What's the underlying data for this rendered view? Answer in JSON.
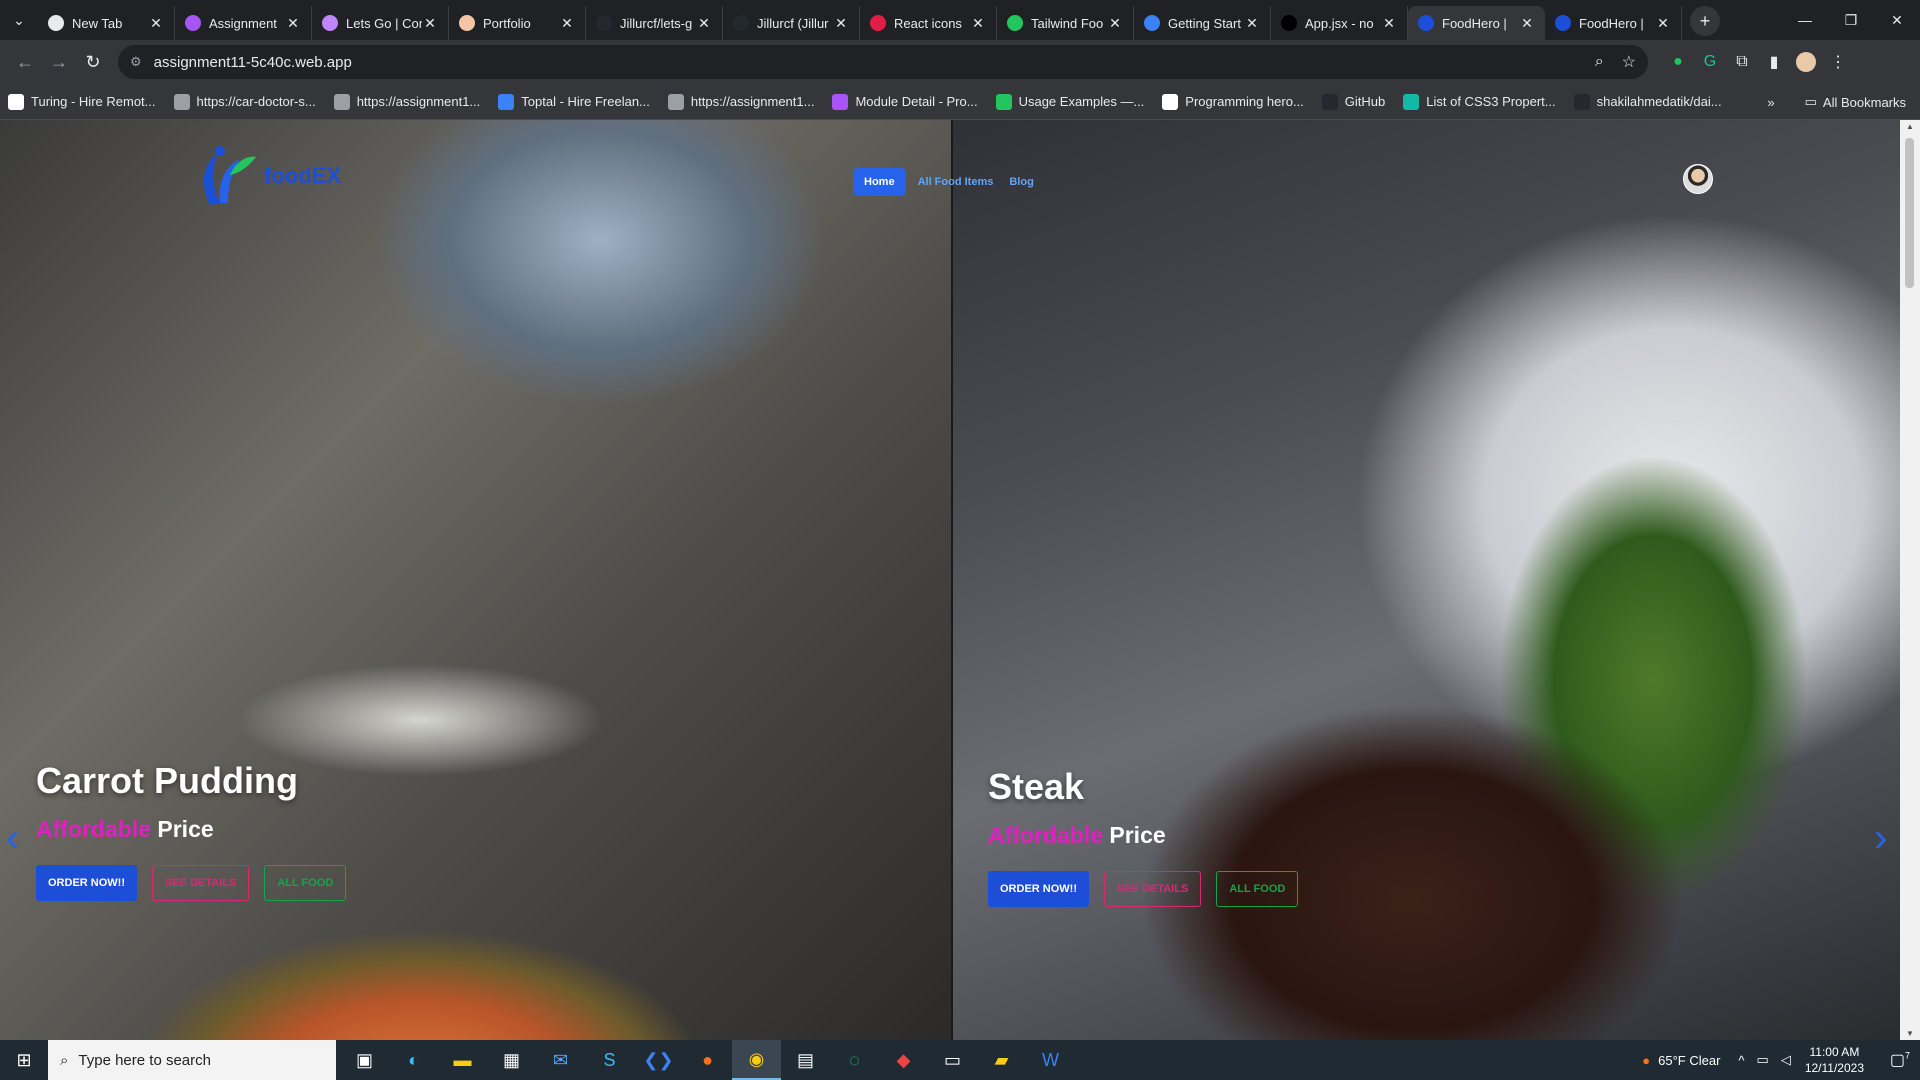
{
  "browser": {
    "tabs": [
      {
        "title": "New Tab",
        "color": "#e8eaed",
        "active": false
      },
      {
        "title": "Assignment",
        "color": "#a855f7",
        "active": false
      },
      {
        "title": "Lets Go | Cor",
        "color": "#c084fc",
        "active": false
      },
      {
        "title": "Portfolio",
        "color": "#f5c6a5",
        "active": false
      },
      {
        "title": "Jillurcf/lets-g",
        "color": "#24292f",
        "active": false
      },
      {
        "title": "Jillurcf (Jillur",
        "color": "#24292f",
        "active": false
      },
      {
        "title": "React icons",
        "color": "#e11d48",
        "active": false
      },
      {
        "title": "Tailwind Foo",
        "color": "#22c55e",
        "active": false
      },
      {
        "title": "Getting Start",
        "color": "#3b82f6",
        "active": false
      },
      {
        "title": "App.jsx - no",
        "color": "#000000",
        "active": false
      },
      {
        "title": "FoodHero |",
        "color": "#1d4ed8",
        "active": true
      },
      {
        "title": "FoodHero |",
        "color": "#1d4ed8",
        "active": false
      }
    ],
    "url": "assignment11-5c40c.web.app",
    "bookmarks": [
      {
        "label": "Turing - Hire Remot...",
        "color": "#ffffff"
      },
      {
        "label": "https://car-doctor-s...",
        "color": "#9aa0a6"
      },
      {
        "label": "https://assignment1...",
        "color": "#9aa0a6"
      },
      {
        "label": "Toptal - Hire Freelan...",
        "color": "#3b82f6"
      },
      {
        "label": "https://assignment1...",
        "color": "#9aa0a6"
      },
      {
        "label": "Module Detail - Pro...",
        "color": "#a855f7"
      },
      {
        "label": "Usage Examples —...",
        "color": "#22c55e"
      },
      {
        "label": "Programming hero...",
        "color": "#ffffff"
      },
      {
        "label": "GitHub",
        "color": "#24292f"
      },
      {
        "label": "List of CSS3 Propert...",
        "color": "#14b8a6"
      },
      {
        "label": "shakilahmedatik/dai...",
        "color": "#24292f"
      }
    ],
    "all_bookmarks": "All Bookmarks"
  },
  "site": {
    "logo_text": "foodEX",
    "nav": [
      {
        "label": "Home",
        "active": true
      },
      {
        "label": "All Food Items",
        "active": false
      },
      {
        "label": "Blog",
        "active": false
      }
    ],
    "slides": [
      {
        "title": "Carrot Pudding",
        "accent": "Affordable",
        "rest": "Price",
        "buttons": [
          "ORDER NOW!!",
          "SEE DETAILS",
          "ALL FOOD"
        ]
      },
      {
        "title": "Steak",
        "accent": "Affordable",
        "rest": "Price",
        "buttons": [
          "ORDER NOW!!",
          "SEE DETAILS",
          "ALL FOOD"
        ]
      }
    ]
  },
  "taskbar": {
    "search_placeholder": "Type here to search",
    "weather": "65°F  Clear",
    "time": "11:00 AM",
    "date": "12/11/2023",
    "notification_count": "7"
  }
}
